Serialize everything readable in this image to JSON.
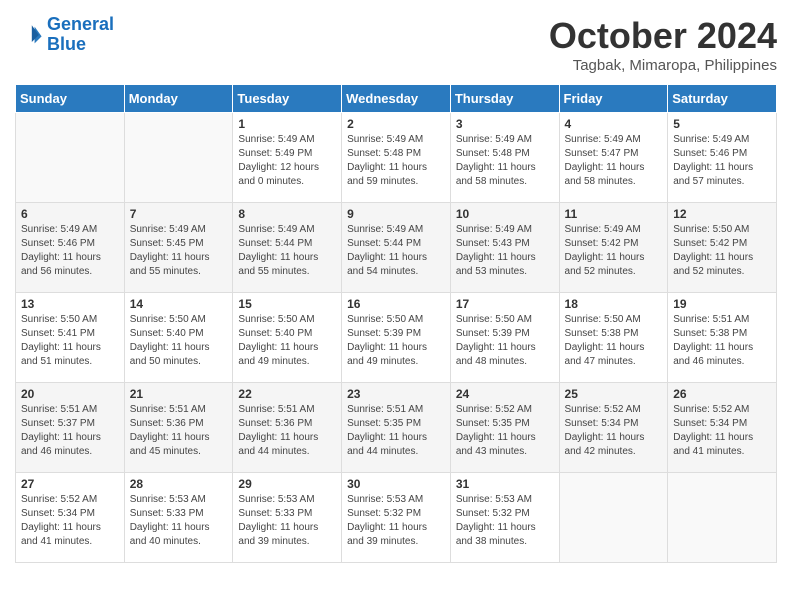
{
  "header": {
    "logo_line1": "General",
    "logo_line2": "Blue",
    "month_year": "October 2024",
    "location": "Tagbak, Mimaropa, Philippines"
  },
  "weekdays": [
    "Sunday",
    "Monday",
    "Tuesday",
    "Wednesday",
    "Thursday",
    "Friday",
    "Saturday"
  ],
  "weeks": [
    [
      {
        "day": "",
        "content": ""
      },
      {
        "day": "",
        "content": ""
      },
      {
        "day": "1",
        "content": "Sunrise: 5:49 AM\nSunset: 5:49 PM\nDaylight: 12 hours\nand 0 minutes."
      },
      {
        "day": "2",
        "content": "Sunrise: 5:49 AM\nSunset: 5:48 PM\nDaylight: 11 hours\nand 59 minutes."
      },
      {
        "day": "3",
        "content": "Sunrise: 5:49 AM\nSunset: 5:48 PM\nDaylight: 11 hours\nand 58 minutes."
      },
      {
        "day": "4",
        "content": "Sunrise: 5:49 AM\nSunset: 5:47 PM\nDaylight: 11 hours\nand 58 minutes."
      },
      {
        "day": "5",
        "content": "Sunrise: 5:49 AM\nSunset: 5:46 PM\nDaylight: 11 hours\nand 57 minutes."
      }
    ],
    [
      {
        "day": "6",
        "content": "Sunrise: 5:49 AM\nSunset: 5:46 PM\nDaylight: 11 hours\nand 56 minutes."
      },
      {
        "day": "7",
        "content": "Sunrise: 5:49 AM\nSunset: 5:45 PM\nDaylight: 11 hours\nand 55 minutes."
      },
      {
        "day": "8",
        "content": "Sunrise: 5:49 AM\nSunset: 5:44 PM\nDaylight: 11 hours\nand 55 minutes."
      },
      {
        "day": "9",
        "content": "Sunrise: 5:49 AM\nSunset: 5:44 PM\nDaylight: 11 hours\nand 54 minutes."
      },
      {
        "day": "10",
        "content": "Sunrise: 5:49 AM\nSunset: 5:43 PM\nDaylight: 11 hours\nand 53 minutes."
      },
      {
        "day": "11",
        "content": "Sunrise: 5:49 AM\nSunset: 5:42 PM\nDaylight: 11 hours\nand 52 minutes."
      },
      {
        "day": "12",
        "content": "Sunrise: 5:50 AM\nSunset: 5:42 PM\nDaylight: 11 hours\nand 52 minutes."
      }
    ],
    [
      {
        "day": "13",
        "content": "Sunrise: 5:50 AM\nSunset: 5:41 PM\nDaylight: 11 hours\nand 51 minutes."
      },
      {
        "day": "14",
        "content": "Sunrise: 5:50 AM\nSunset: 5:40 PM\nDaylight: 11 hours\nand 50 minutes."
      },
      {
        "day": "15",
        "content": "Sunrise: 5:50 AM\nSunset: 5:40 PM\nDaylight: 11 hours\nand 49 minutes."
      },
      {
        "day": "16",
        "content": "Sunrise: 5:50 AM\nSunset: 5:39 PM\nDaylight: 11 hours\nand 49 minutes."
      },
      {
        "day": "17",
        "content": "Sunrise: 5:50 AM\nSunset: 5:39 PM\nDaylight: 11 hours\nand 48 minutes."
      },
      {
        "day": "18",
        "content": "Sunrise: 5:50 AM\nSunset: 5:38 PM\nDaylight: 11 hours\nand 47 minutes."
      },
      {
        "day": "19",
        "content": "Sunrise: 5:51 AM\nSunset: 5:38 PM\nDaylight: 11 hours\nand 46 minutes."
      }
    ],
    [
      {
        "day": "20",
        "content": "Sunrise: 5:51 AM\nSunset: 5:37 PM\nDaylight: 11 hours\nand 46 minutes."
      },
      {
        "day": "21",
        "content": "Sunrise: 5:51 AM\nSunset: 5:36 PM\nDaylight: 11 hours\nand 45 minutes."
      },
      {
        "day": "22",
        "content": "Sunrise: 5:51 AM\nSunset: 5:36 PM\nDaylight: 11 hours\nand 44 minutes."
      },
      {
        "day": "23",
        "content": "Sunrise: 5:51 AM\nSunset: 5:35 PM\nDaylight: 11 hours\nand 44 minutes."
      },
      {
        "day": "24",
        "content": "Sunrise: 5:52 AM\nSunset: 5:35 PM\nDaylight: 11 hours\nand 43 minutes."
      },
      {
        "day": "25",
        "content": "Sunrise: 5:52 AM\nSunset: 5:34 PM\nDaylight: 11 hours\nand 42 minutes."
      },
      {
        "day": "26",
        "content": "Sunrise: 5:52 AM\nSunset: 5:34 PM\nDaylight: 11 hours\nand 41 minutes."
      }
    ],
    [
      {
        "day": "27",
        "content": "Sunrise: 5:52 AM\nSunset: 5:34 PM\nDaylight: 11 hours\nand 41 minutes."
      },
      {
        "day": "28",
        "content": "Sunrise: 5:53 AM\nSunset: 5:33 PM\nDaylight: 11 hours\nand 40 minutes."
      },
      {
        "day": "29",
        "content": "Sunrise: 5:53 AM\nSunset: 5:33 PM\nDaylight: 11 hours\nand 39 minutes."
      },
      {
        "day": "30",
        "content": "Sunrise: 5:53 AM\nSunset: 5:32 PM\nDaylight: 11 hours\nand 39 minutes."
      },
      {
        "day": "31",
        "content": "Sunrise: 5:53 AM\nSunset: 5:32 PM\nDaylight: 11 hours\nand 38 minutes."
      },
      {
        "day": "",
        "content": ""
      },
      {
        "day": "",
        "content": ""
      }
    ]
  ]
}
